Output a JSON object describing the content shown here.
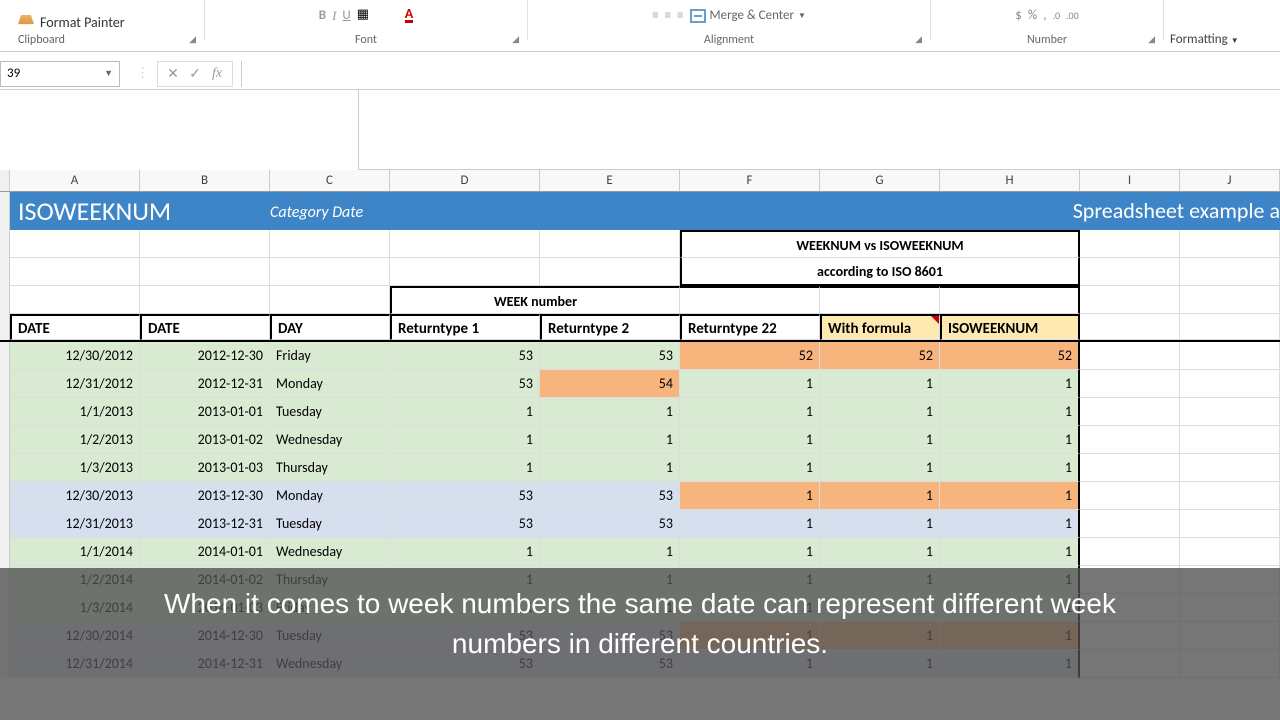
{
  "ribbon": {
    "format_painter": "Format Painter",
    "clipboard": "Clipboard",
    "font": "Font",
    "alignment": "Alignment",
    "number": "Number",
    "merge": "Merge & Center",
    "formatting": "Formatting",
    "dec_dec": ".00",
    "currency": "$",
    "percent": "%"
  },
  "namebox": "39",
  "fx": "fx",
  "columns": [
    "A",
    "B",
    "C",
    "D",
    "E",
    "F",
    "G",
    "H",
    "I",
    "J"
  ],
  "banner": {
    "name": "ISOWEEKNUM",
    "category": "Category Date",
    "right": "Spreadsheet example a"
  },
  "merged": {
    "wk_vs_iso": "WEEKNUM vs  ISOWEEKNUM",
    "according": "according to ISO 8601",
    "week_number": "WEEK number"
  },
  "headers": {
    "date1": "DATE",
    "date2": "DATE",
    "day": "DAY",
    "rt1": "Returntype 1",
    "rt2": "Returntype 2",
    "rt22": "Returntype 22",
    "with_formula": "With formula",
    "isoweeknum": "ISOWEEKNUM"
  },
  "rows": [
    {
      "d1": "12/30/2012",
      "d2": "2012-12-30",
      "day": "Friday",
      "r1": 53,
      "r2": 53,
      "r22": 52,
      "wf": 52,
      "iso": 52,
      "bg": "bg-green",
      "hl": "r22"
    },
    {
      "d1": "12/31/2012",
      "d2": "2012-12-31",
      "day": "Monday",
      "r1": 53,
      "r2": 54,
      "r22": 1,
      "wf": 1,
      "iso": 1,
      "bg": "bg-green",
      "hl": "r2"
    },
    {
      "d1": "1/1/2013",
      "d2": "2013-01-01",
      "day": "Tuesday",
      "r1": 1,
      "r2": 1,
      "r22": 1,
      "wf": 1,
      "iso": 1,
      "bg": "bg-green"
    },
    {
      "d1": "1/2/2013",
      "d2": "2013-01-02",
      "day": "Wednesday",
      "r1": 1,
      "r2": 1,
      "r22": 1,
      "wf": 1,
      "iso": 1,
      "bg": "bg-green"
    },
    {
      "d1": "1/3/2013",
      "d2": "2013-01-03",
      "day": "Thursday",
      "r1": 1,
      "r2": 1,
      "r22": 1,
      "wf": 1,
      "iso": 1,
      "bg": "bg-green"
    },
    {
      "d1": "12/30/2013",
      "d2": "2013-12-30",
      "day": "Monday",
      "r1": 53,
      "r2": 53,
      "r22": 1,
      "wf": 1,
      "iso": 1,
      "bg": "bg-blue",
      "hl": "r22"
    },
    {
      "d1": "12/31/2013",
      "d2": "2013-12-31",
      "day": "Tuesday",
      "r1": 53,
      "r2": 53,
      "r22": 1,
      "wf": 1,
      "iso": 1,
      "bg": "bg-blue"
    },
    {
      "d1": "1/1/2014",
      "d2": "2014-01-01",
      "day": "Wednesday",
      "r1": 1,
      "r2": 1,
      "r22": 1,
      "wf": 1,
      "iso": 1,
      "bg": "bg-green"
    },
    {
      "d1": "1/2/2014",
      "d2": "2014-01-02",
      "day": "Thursday",
      "r1": 1,
      "r2": 1,
      "r22": 1,
      "wf": 1,
      "iso": 1,
      "bg": "bg-green"
    },
    {
      "d1": "1/3/2014",
      "d2": "2014-01-03",
      "day": "Friday",
      "r1": 1,
      "r2": 1,
      "r22": 1,
      "wf": 1,
      "iso": 1,
      "bg": "bg-green"
    },
    {
      "d1": "12/30/2014",
      "d2": "2014-12-30",
      "day": "Tuesday",
      "r1": 53,
      "r2": 53,
      "r22": 1,
      "wf": 1,
      "iso": 1,
      "bg": "bg-blue",
      "hl": "r22"
    },
    {
      "d1": "12/31/2014",
      "d2": "2014-12-31",
      "day": "Wednesday",
      "r1": 53,
      "r2": 53,
      "r22": 1,
      "wf": 1,
      "iso": 1,
      "bg": "bg-blue"
    }
  ],
  "caption": "When it comes to week numbers the same date can represent different week numbers in different countries."
}
